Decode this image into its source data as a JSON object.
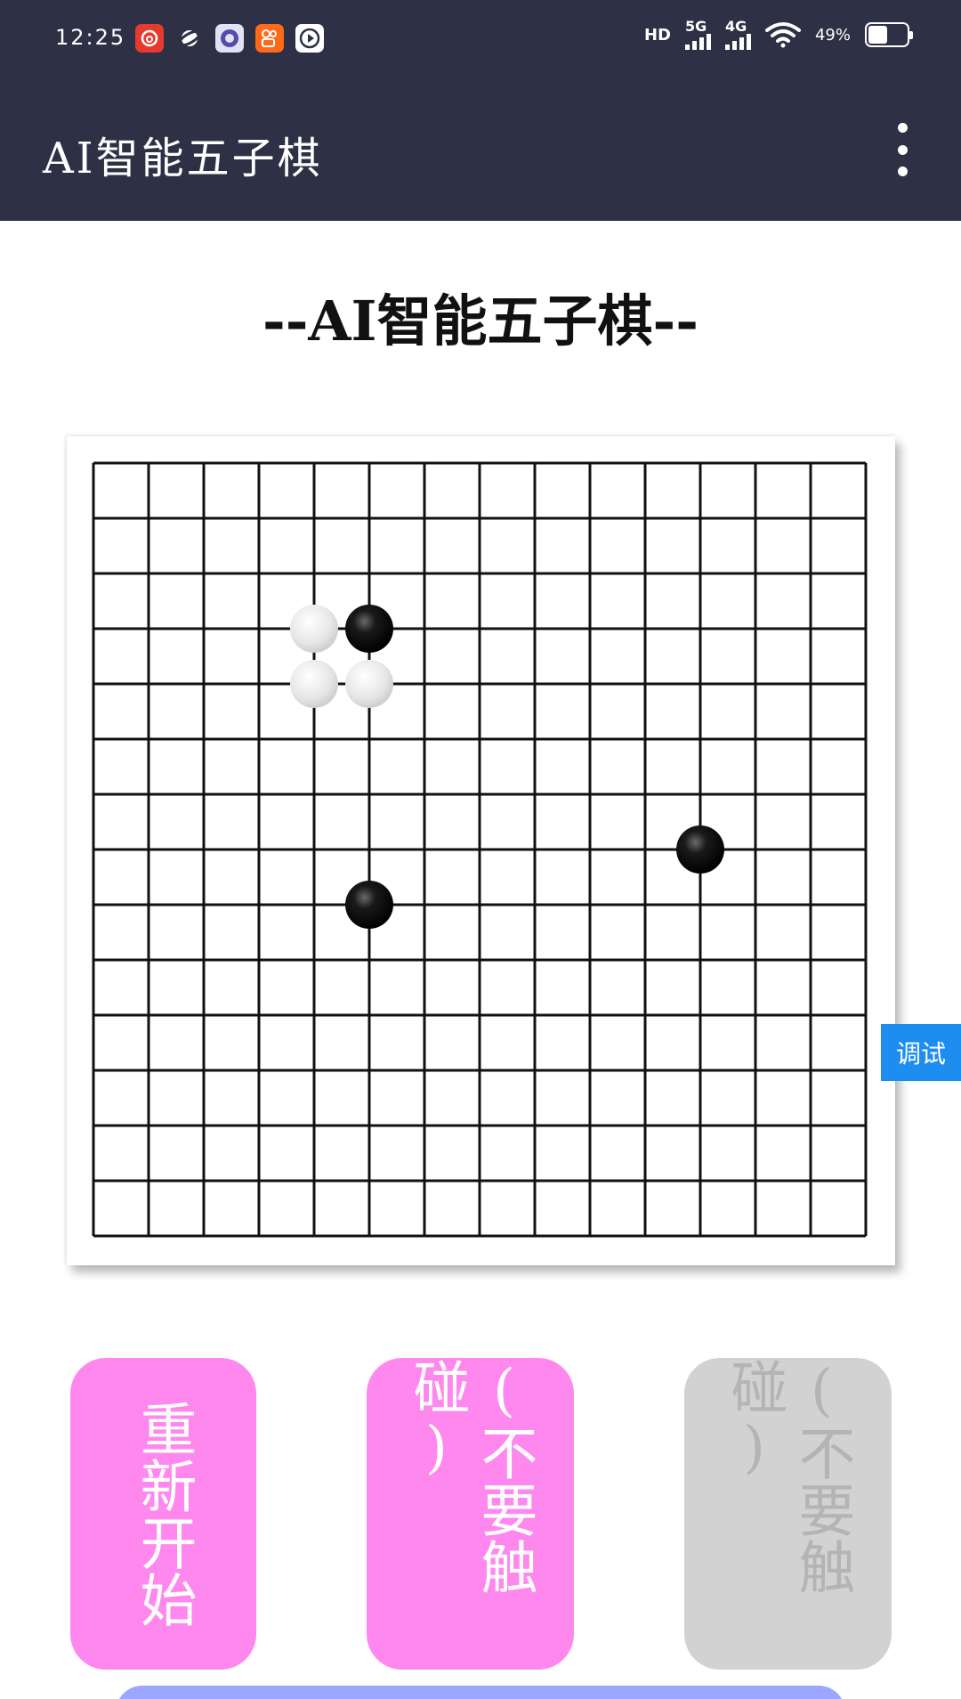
{
  "status_bar": {
    "time": "12:25",
    "hd": "HD",
    "network_5g": "5G",
    "network_4g": "4G",
    "battery_text": "49%",
    "battery_level": 0.49,
    "notification_icons": [
      {
        "icon": "netease-music-icon",
        "color": "#e63a2e"
      },
      {
        "icon": "planet-app-icon",
        "color": "#2e3046"
      },
      {
        "icon": "university-badge-icon",
        "color": "#dfe3f5"
      },
      {
        "icon": "kuaishou-icon",
        "color": "#ff6a1a"
      },
      {
        "icon": "video-play-icon",
        "color": "#ffffff"
      }
    ]
  },
  "app_bar": {
    "title": "AI智能五子棋",
    "menu_icon": "more-vertical-icon",
    "background": "#2e3046"
  },
  "heading": "--AI智能五子棋--",
  "board": {
    "size": 15,
    "stones": [
      {
        "row": 3,
        "col": 4,
        "color": "white"
      },
      {
        "row": 3,
        "col": 5,
        "color": "black"
      },
      {
        "row": 4,
        "col": 4,
        "color": "white"
      },
      {
        "row": 4,
        "col": 5,
        "color": "white"
      },
      {
        "row": 7,
        "col": 11,
        "color": "black"
      },
      {
        "row": 8,
        "col": 5,
        "color": "black"
      }
    ]
  },
  "debug_tab": {
    "label": "调试",
    "color": "#1e8df0"
  },
  "buttons": {
    "restart": "重新开始",
    "dont_touch_1": "(不要触碰)",
    "dont_touch_2": "(不要触碰)",
    "active_color": "#ff88ee",
    "disabled_color": "#d2d2d2"
  }
}
